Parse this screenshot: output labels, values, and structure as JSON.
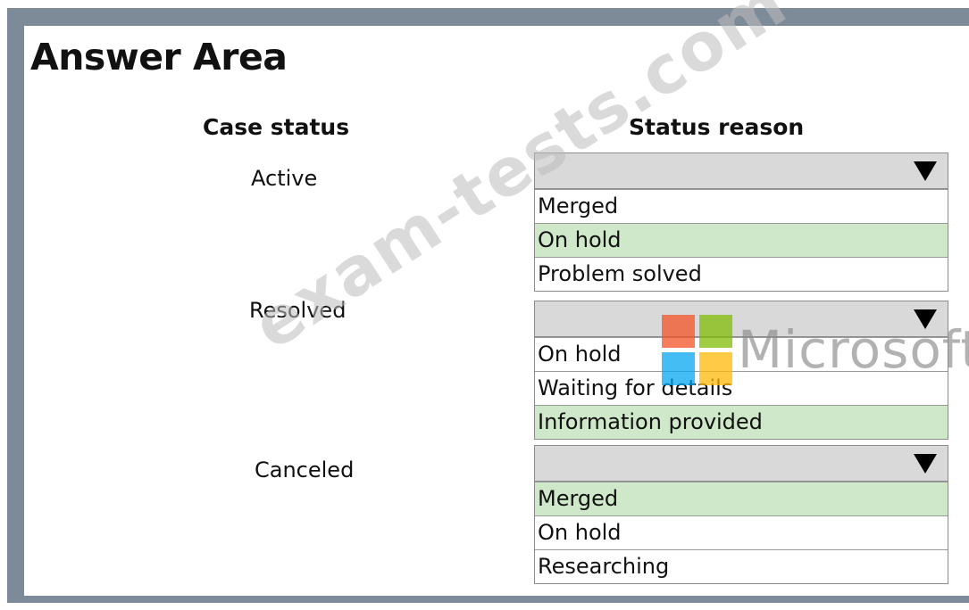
{
  "title": "Answer Area",
  "headers": {
    "case_status": "Case status",
    "status_reason": "Status reason"
  },
  "rows": [
    {
      "status": "Active",
      "options": [
        "Merged",
        "On hold",
        "Problem solved"
      ],
      "selected": "On hold"
    },
    {
      "status": "Resolved",
      "options": [
        "On hold",
        "Waiting for details",
        "Information provided"
      ],
      "selected": "Information provided"
    },
    {
      "status": "Canceled",
      "options": [
        "Merged",
        "On hold",
        "Researching"
      ],
      "selected": "Merged"
    }
  ],
  "logo_text": "Microsoft",
  "watermark": "exam-tests.com",
  "colors": {
    "selected_bg": "#cfe8c9",
    "dropdown_head": "#d9d9d9",
    "frame": "#7d8a98"
  }
}
